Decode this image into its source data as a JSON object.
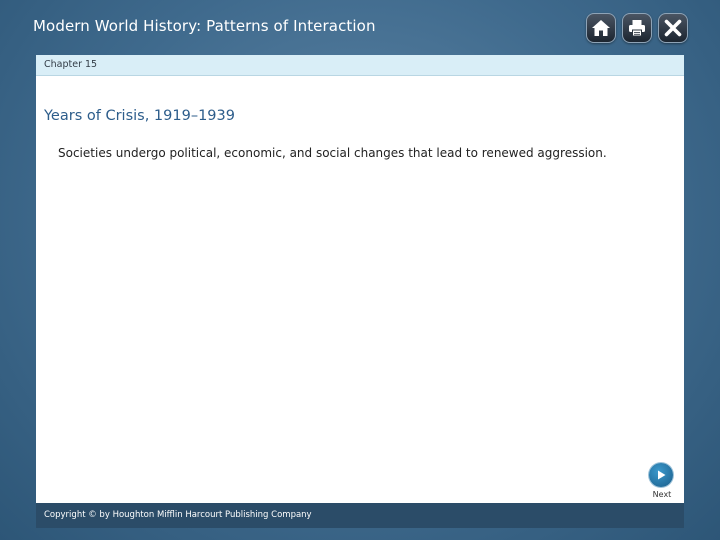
{
  "header": {
    "title": "Modern World History: Patterns of Interaction",
    "buttons": [
      {
        "icon": "home-icon"
      },
      {
        "icon": "print-icon"
      },
      {
        "icon": "close-icon"
      }
    ]
  },
  "chapter": {
    "label": "Chapter 15"
  },
  "main": {
    "section_title": "Years of Crisis, 1919–1939",
    "summary": "Societies undergo political, economic, and social changes that lead to renewed aggression."
  },
  "navigation": {
    "next_label": "Next",
    "next_icon": "play-arrow-icon"
  },
  "footer": {
    "copyright": "Copyright © by Houghton Mifflin Harcourt Publishing Company"
  },
  "colors": {
    "background": "#3f6a8d",
    "chapter_bar": "#d9eef7",
    "section_title": "#2d5d8b",
    "footer": "#2b4c68",
    "next_button": "#1a5d8a"
  }
}
